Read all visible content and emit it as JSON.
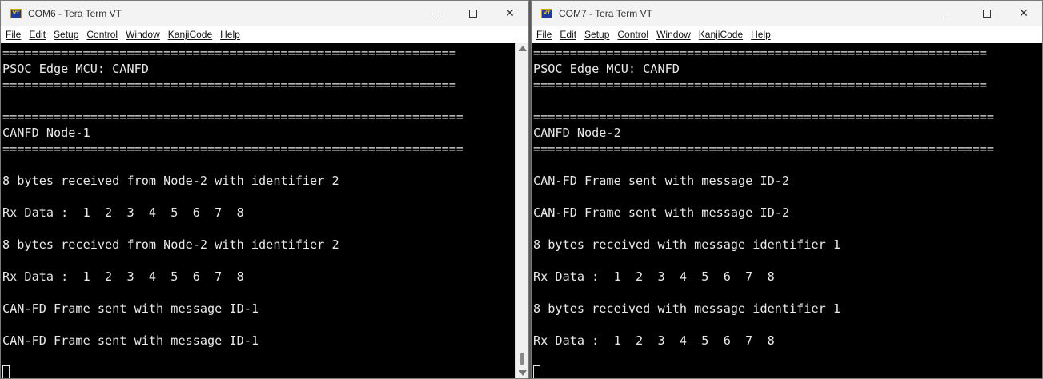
{
  "windows": [
    {
      "title": "COM6 - Tera Term VT",
      "icon_label": "VT",
      "menu": [
        "File",
        "Edit",
        "Setup",
        "Control",
        "Window",
        "KanjiCode",
        "Help"
      ],
      "lines": [
        "==============================================================",
        "PSOC Edge MCU: CANFD",
        "==============================================================",
        "",
        "===============================================================",
        "CANFD Node-1",
        "===============================================================",
        "",
        "8 bytes received from Node-2 with identifier 2",
        "",
        "Rx Data :  1  2  3  4  5  6  7  8",
        "",
        "8 bytes received from Node-2 with identifier 2",
        "",
        "Rx Data :  1  2  3  4  5  6  7  8",
        "",
        "CAN-FD Frame sent with message ID-1",
        "",
        "CAN-FD Frame sent with message ID-1",
        ""
      ]
    },
    {
      "title": "COM7 - Tera Term VT",
      "icon_label": "VT",
      "menu": [
        "File",
        "Edit",
        "Setup",
        "Control",
        "Window",
        "KanjiCode",
        "Help"
      ],
      "lines": [
        "==============================================================",
        "PSOC Edge MCU: CANFD",
        "==============================================================",
        "",
        "===============================================================",
        "CANFD Node-2",
        "===============================================================",
        "",
        "CAN-FD Frame sent with message ID-2",
        "",
        "CAN-FD Frame sent with message ID-2",
        "",
        "8 bytes received with message identifier 1",
        "",
        "Rx Data :  1  2  3  4  5  6  7  8",
        "",
        "8 bytes received with message identifier 1",
        "",
        "Rx Data :  1  2  3  4  5  6  7  8",
        ""
      ]
    }
  ]
}
